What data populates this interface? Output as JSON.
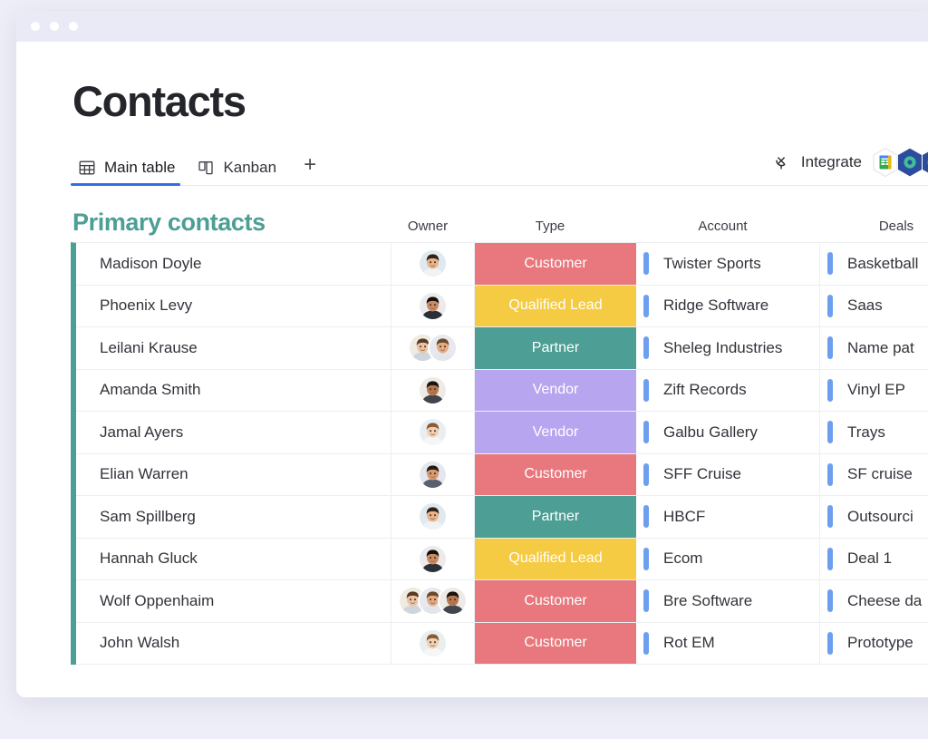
{
  "window": {
    "dots": [
      "dot-1",
      "dot-2",
      "dot-3"
    ]
  },
  "page": {
    "title": "Contacts"
  },
  "tabs": {
    "items": [
      {
        "label": "Main table",
        "icon": "table-icon",
        "active": true
      },
      {
        "label": "Kanban",
        "icon": "kanban-icon",
        "active": false
      }
    ],
    "add_label": "+"
  },
  "toolbar": {
    "integrate_label": "Integrate",
    "integrate_icon": "plug-icon",
    "integration_apps": [
      "google-sheets-icon",
      "app-blue-icon",
      "app-navy-icon"
    ]
  },
  "board": {
    "group_title": "Primary contacts",
    "group_color": "#4d9e94",
    "columns": [
      {
        "key": "name",
        "label": ""
      },
      {
        "key": "owner",
        "label": "Owner"
      },
      {
        "key": "type",
        "label": "Type"
      },
      {
        "key": "account",
        "label": "Account"
      },
      {
        "key": "deals",
        "label": "Deals"
      }
    ],
    "type_colors": {
      "Customer": "#e8787d",
      "Qualified Lead": "#f5cb43",
      "Partner": "#4d9e94",
      "Vendor": "#b8a5f0"
    },
    "link_bar_color": "#6c9ff0",
    "rows": [
      {
        "name": "Madison Doyle",
        "owners": 1,
        "type": "Customer",
        "account": "Twister Sports",
        "deals": "Basketball"
      },
      {
        "name": "Phoenix Levy",
        "owners": 1,
        "type": "Qualified Lead",
        "account": "Ridge Software",
        "deals": "Saas"
      },
      {
        "name": "Leilani Krause",
        "owners": 2,
        "type": "Partner",
        "account": "Sheleg Industries",
        "deals": "Name pat"
      },
      {
        "name": "Amanda Smith",
        "owners": 1,
        "type": "Vendor",
        "account": "Zift Records",
        "deals": "Vinyl EP"
      },
      {
        "name": "Jamal Ayers",
        "owners": 1,
        "type": "Vendor",
        "account": "Galbu Gallery",
        "deals": "Trays"
      },
      {
        "name": "Elian Warren",
        "owners": 1,
        "type": "Customer",
        "account": "SFF Cruise",
        "deals": "SF cruise"
      },
      {
        "name": "Sam Spillberg",
        "owners": 1,
        "type": "Partner",
        "account": "HBCF",
        "deals": "Outsourci"
      },
      {
        "name": "Hannah Gluck",
        "owners": 1,
        "type": "Qualified Lead",
        "account": "Ecom",
        "deals": "Deal 1"
      },
      {
        "name": "Wolf Oppenhaim",
        "owners": 3,
        "type": "Customer",
        "account": "Bre Software",
        "deals": "Cheese da"
      },
      {
        "name": "John Walsh",
        "owners": 1,
        "type": "Customer",
        "account": "Rot EM",
        "deals": "Prototype"
      }
    ]
  }
}
